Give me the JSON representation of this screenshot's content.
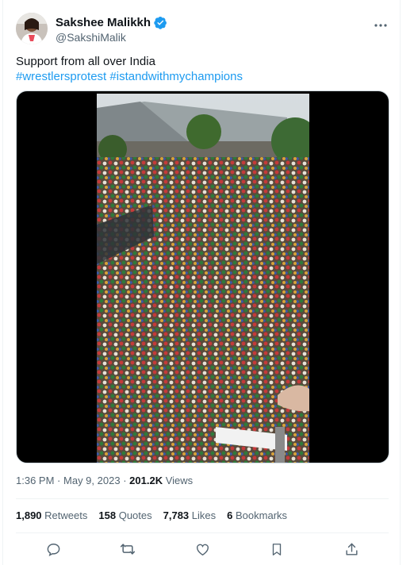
{
  "author": {
    "display_name": "Sakshee Malikkh",
    "handle": "@SakshiMalik",
    "verified": true
  },
  "tweet": {
    "text": "Support from all over India",
    "hashtags": [
      "#wrestlersprotest",
      "#istandwithmychampions"
    ]
  },
  "meta": {
    "time": "1:36 PM",
    "date": "May 9, 2023",
    "separator": "·",
    "views_count": "201.2K",
    "views_label": "Views"
  },
  "stats": [
    {
      "num": "1,890",
      "label": "Retweets"
    },
    {
      "num": "158",
      "label": "Quotes"
    },
    {
      "num": "7,783",
      "label": "Likes"
    },
    {
      "num": "6",
      "label": "Bookmarks"
    }
  ],
  "actions": [
    "reply-icon",
    "retweet-icon",
    "like-icon",
    "bookmark-icon",
    "share-icon"
  ],
  "colors": {
    "accent": "#1d9bf0",
    "text": "#0f1419",
    "muted": "#536471",
    "divider": "#eff3f4"
  }
}
